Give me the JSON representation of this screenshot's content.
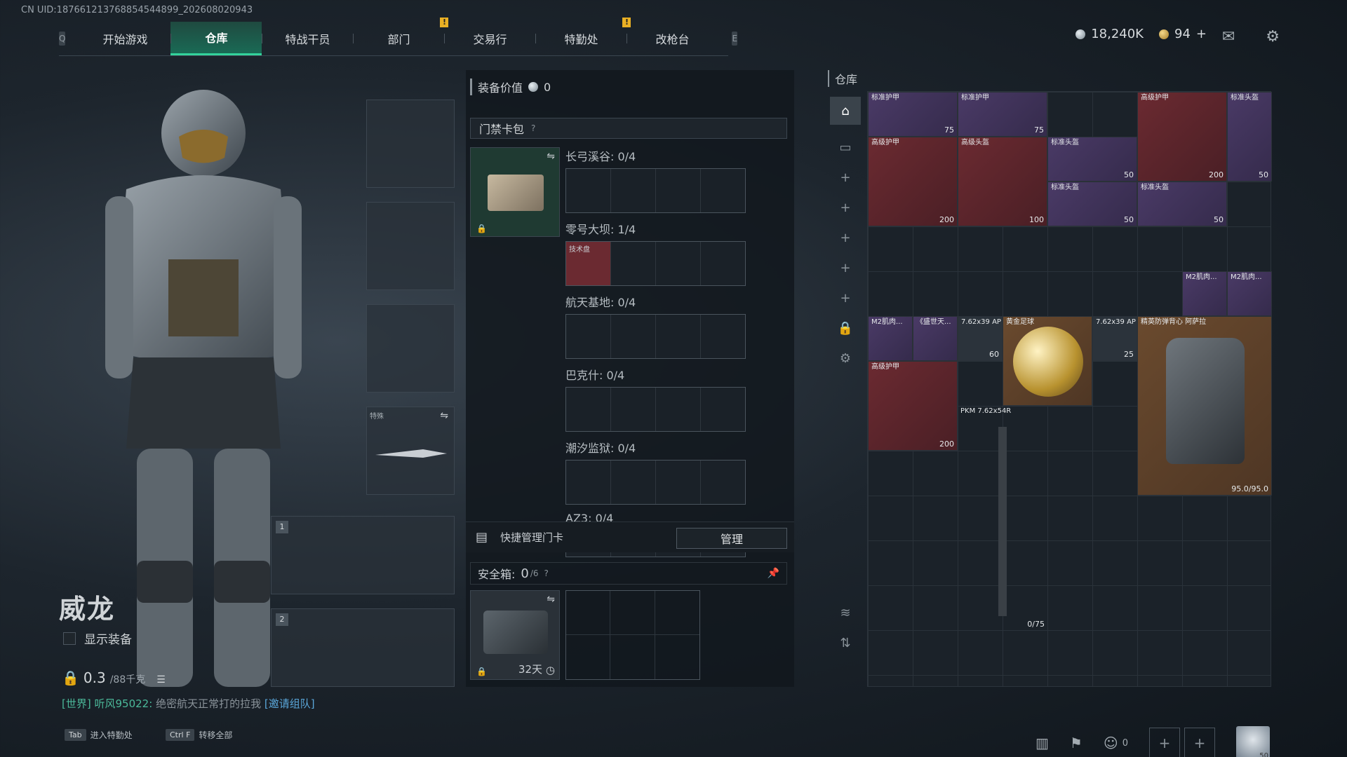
{
  "uid": "CN UID:18766121376885454489​9_202608020943",
  "nav": {
    "left_key": "Q",
    "right_key": "E",
    "tabs": [
      "开始游戏",
      "仓库",
      "特战干员",
      "部门",
      "交易行",
      "特勤处",
      "改枪台"
    ],
    "active_tab": "仓库"
  },
  "currency": {
    "silver": "18,240K",
    "gold": "94",
    "plus": "+"
  },
  "character": {
    "name": "威龙",
    "show_equipment_label": "显示装备",
    "weight_value": "0.3",
    "weight_unit": "/88千克",
    "chat_channel": "[世界]",
    "chat_user": "听风95022:",
    "chat_message": "绝密航天正常打的拉我",
    "chat_link": "[邀请组队]"
  },
  "hints": [
    {
      "key": "Tab",
      "label": "进入特勤处"
    },
    {
      "key": "Ctrl F",
      "label": "转移全部"
    }
  ],
  "slots": {
    "melee_title": "特殊",
    "weapon1_num": "1",
    "weapon2_num": "2"
  },
  "middle": {
    "equip_value_label": "装备价值",
    "equip_value": "0",
    "keycard_title": "门禁卡包",
    "keycard_help": "?",
    "maps": [
      {
        "label": "长弓溪谷: 0/4"
      },
      {
        "label": "零号大坝: 1/4",
        "item": "技术盘"
      },
      {
        "label": "航天基地: 0/4"
      },
      {
        "label": "巴克什: 0/4"
      },
      {
        "label": "潮汐监狱: 0/4"
      },
      {
        "label": "AZ3: 0/4"
      }
    ],
    "quick_manage_label": "快捷管理门卡",
    "manage_button": "管理",
    "safebox_label": "安全箱:",
    "safebox_count": "0",
    "safebox_total": "/6",
    "safebox_days": "32天"
  },
  "inventory": {
    "title": "仓库",
    "items": [
      {
        "name": "标准护甲",
        "count": "75",
        "tier": "purple"
      },
      {
        "name": "标准护甲",
        "count": "75",
        "tier": "purple"
      },
      {
        "name": "高级护甲",
        "count": "200",
        "tier": "red"
      },
      {
        "name": "标准头盔",
        "count": "50",
        "tier": "purple"
      },
      {
        "name": "高级护甲",
        "count": "200",
        "tier": "red"
      },
      {
        "name": "高级头盔",
        "count": "100",
        "tier": "red"
      },
      {
        "name": "标准头盔",
        "count": "50",
        "tier": "purple"
      },
      {
        "name": "标准头盔",
        "count": "50",
        "tier": "purple"
      },
      {
        "name": "标准头盔",
        "count": "50",
        "tier": "purple"
      },
      {
        "name": "M2肌肉...",
        "count": "",
        "tier": "purple"
      },
      {
        "name": "M2肌肉...",
        "count": "",
        "tier": "purple"
      },
      {
        "name": "M2肌肉...",
        "count": "",
        "tier": "purple"
      },
      {
        "name": "《盛世天...",
        "count": "",
        "tier": "purple"
      },
      {
        "name": "7.62x39 AP",
        "count": "60",
        "tier": "grey"
      },
      {
        "name": "黄金足球",
        "count": "",
        "tier": "gold"
      },
      {
        "name": "7.62x39 AP",
        "count": "25",
        "tier": "grey"
      },
      {
        "name": "精英防弹背心 阿萨拉",
        "count": "95.0/95.0",
        "tier": "gold"
      },
      {
        "name": "高级护甲",
        "count": "200",
        "tier": "red"
      },
      {
        "name": "PKM 7.62x54R",
        "count": "0/75",
        "tier": "grey"
      }
    ]
  },
  "bottom": {
    "friends": "0",
    "avatar_level": "50"
  }
}
